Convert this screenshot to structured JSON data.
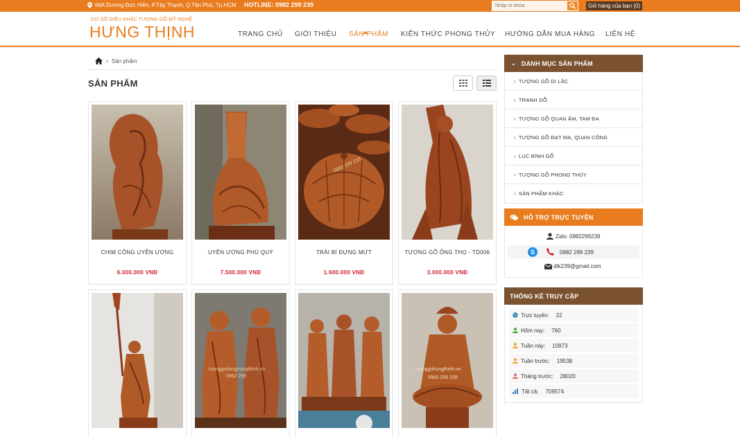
{
  "topbar": {
    "address": "68A Dương Đức Hiền, P.Tây Thạnh, Q.Tân Phú, Tp.HCM",
    "hotline": "HOTLINE: 0982 299 239",
    "search_placeholder": "Nhập từ khóa",
    "cart": "Giỏ hàng của bạn (0)"
  },
  "brand": {
    "tagline": "CƠ SỞ ĐIÊU KHẮC TƯỢNG GỖ MỸ NGHỆ",
    "name": "HƯNG THỊNH"
  },
  "nav": {
    "items": [
      {
        "label": "TRANG CHỦ"
      },
      {
        "label": "GIỚI THIỆU"
      },
      {
        "label": "SẢN PHẨM"
      },
      {
        "label": "KIẾN THỨC PHONG THỦY"
      },
      {
        "label": "HƯỚNG DẪN MUA HÀNG"
      },
      {
        "label": "LIÊN HỆ"
      }
    ],
    "active_index": 2
  },
  "breadcrumb": {
    "current": "Sản phẩm"
  },
  "page_title": "SẢN PHẨM",
  "products": [
    {
      "name": "CHIM CÔNG UYÊN ƯƠNG",
      "price": "6.000.000 VNĐ"
    },
    {
      "name": "UYÊN ƯƠNG PHÚ QUÝ",
      "price": "7.500.000 VNĐ"
    },
    {
      "name": "TRÁI BÍ ĐỰNG MỨT",
      "price": "1.600.000 VNĐ"
    },
    {
      "name": "TƯỢNG GỖ ÔNG THỌ - TD006",
      "price": "3.000.000 VNĐ"
    },
    {
      "name": "",
      "price": ""
    },
    {
      "name": "",
      "price": ""
    },
    {
      "name": "",
      "price": ""
    },
    {
      "name": "",
      "price": ""
    }
  ],
  "image_watermarks": {
    "product_3": "0982 299 239",
    "product_6": "tuonggodonghungthinh.vn",
    "product_6b": "0982 299",
    "product_8": "tuonggohungthinh.vn",
    "product_8b": "0982 299 239"
  },
  "sidebar": {
    "categories_title": "DANH MỤC SẢN PHẨM",
    "categories": [
      {
        "label": "TƯỢNG GỖ DI LẶC"
      },
      {
        "label": "TRANH GỖ"
      },
      {
        "label": "TƯỢNG GỖ QUAN ÂM, TAM ĐA"
      },
      {
        "label": "TƯỢNG GỖ ĐẠT MA, QUAN CÔNG"
      },
      {
        "label": "LỤC BÌNH GỖ"
      },
      {
        "label": "TƯỢNG GỖ PHONG THỦY"
      },
      {
        "label": "SẢN PHẨM KHÁC"
      }
    ],
    "support_title": "HỖ TRỢ TRỰC TUYẾN",
    "support": {
      "zalo": "Zalo: 0982299239",
      "phone": "0982 299 239",
      "email": "dtk239@gmail.com"
    },
    "stats_title": "THỐNG KÊ TRUY CẬP",
    "stats": [
      {
        "label": "Trực tuyến:",
        "value": "22"
      },
      {
        "label": "Hôm nay:",
        "value": "760"
      },
      {
        "label": "Tuần này:",
        "value": "10973"
      },
      {
        "label": "Tuần trước:",
        "value": "19538"
      },
      {
        "label": "Tháng trước:",
        "value": "28020"
      },
      {
        "label": "Tất cả:",
        "value": "709574"
      }
    ]
  },
  "colors": {
    "accent": "#e87c1e",
    "panel_brown": "#7a5230",
    "price": "#d0202a",
    "wood": "#a8522a"
  }
}
